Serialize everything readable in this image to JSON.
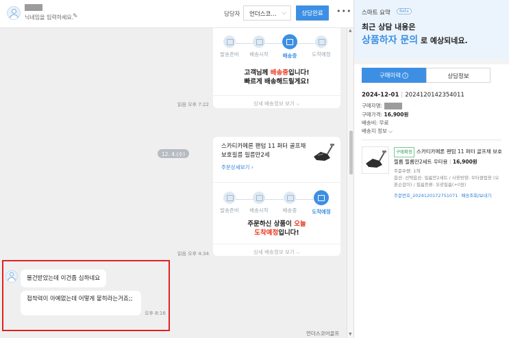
{
  "header": {
    "nickname_placeholder": "닉네임을 입력하세요.",
    "assignee_label": "담당자",
    "assignee_value": "언더스코…",
    "done_button": "상담완료",
    "more": "•••"
  },
  "chat": {
    "card1": {
      "steps": [
        "발송준비",
        "배송시작",
        "배송중",
        "도착예정"
      ],
      "active_step": 2,
      "message_line1_pre": "고객님께 ",
      "message_line1_red": "배송중",
      "message_line1_post": "입니다!",
      "message_line2": "빠르게 배송해드릴게요!",
      "detail_link": "상세 배송정보 보기 ⌵",
      "read": "읽음",
      "time": "오후 7:22"
    },
    "date_divider": "12. 4.(수)",
    "card2": {
      "product_title": "스카티카메론 팬텀 11 퍼터 골프채 보호필름 필름만2세",
      "product_link": "주문상세보기 ›",
      "steps": [
        "발송준비",
        "배송시작",
        "배송중",
        "도착예정"
      ],
      "active_step": 3,
      "message_line1_pre": "주문하신 상품이 ",
      "message_line1_red": "오늘",
      "message_line2_red": "도착예정",
      "message_line2_post": "입니다!",
      "detail_link": "상세 배송정보 보기 ⌵",
      "read": "읽음",
      "time": "오후 4:34"
    },
    "customer": {
      "message1": "물건받았는데 이건좀 심하네요",
      "message2": "접착력이 아예없는데 어떻게 붙히라는거죠;;",
      "time": "오후 8:16"
    },
    "footer_brand": "언더스코어골프"
  },
  "right_panel": {
    "smart_summary_label": "스마트 요약",
    "beta": "Beta",
    "prediction_line1": "최근 상담 내용은",
    "prediction_category": "상품하자 문의",
    "prediction_suffix": " 로 예상되네요.",
    "tabs": [
      "구매이력",
      "상담정보"
    ],
    "order": {
      "date": "2024-12-01",
      "order_no": "2024120142354011",
      "buyer_label": "구매자명:",
      "price_label": "구매가격:",
      "price_value": "16,900원",
      "shipping": "배송비: 무료",
      "address_link": "배송지 정보 ⌵",
      "item": {
        "badge": "구매확정",
        "title": "스카티카메론 팬텀 11 퍼터 골프채 보호필름 필름만2세트 우타용",
        "price": "16,900원",
        "qty": "주문수량: 1개",
        "options": "옵션: 선택옵션: 필름만2세트 / 사용방향: 우타클럽용 (오픈손잡이) / 필름종류: 유광필름(+0원)",
        "link1": "주문번호_2024120172751071",
        "link2": "배송조회/보내기"
      }
    }
  }
}
